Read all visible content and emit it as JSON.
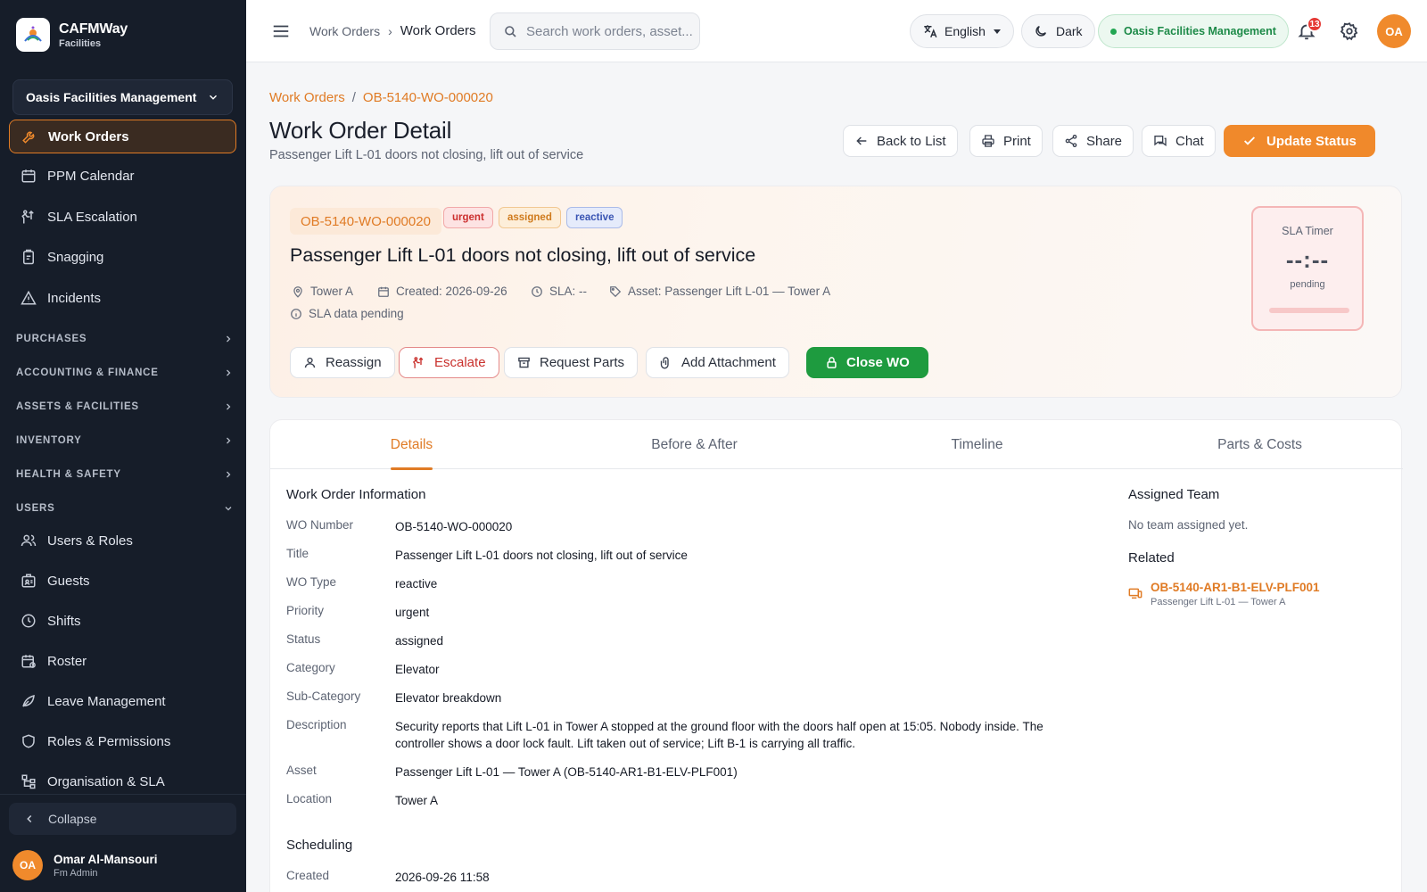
{
  "brand": {
    "name": "CAFMWay",
    "sub": "Facilities"
  },
  "sidebar": {
    "org_select": "Oasis Facilities Management",
    "items": [
      {
        "label": "Work Orders",
        "icon": "wrench-icon"
      },
      {
        "label": "PPM Calendar",
        "icon": "calendar-icon"
      },
      {
        "label": "SLA Escalation",
        "icon": "escalation-icon"
      },
      {
        "label": "Snagging",
        "icon": "clipboard-icon"
      },
      {
        "label": "Incidents",
        "icon": "warning-icon"
      }
    ],
    "sections": [
      "PURCHASES",
      "ACCOUNTING & FINANCE",
      "ASSETS & FACILITIES",
      "INVENTORY",
      "HEALTH & SAFETY",
      "USERS"
    ],
    "user_items": [
      {
        "label": "Users & Roles",
        "icon": "users-icon"
      },
      {
        "label": "Guests",
        "icon": "guest-badge-icon"
      },
      {
        "label": "Shifts",
        "icon": "clock-icon"
      },
      {
        "label": "Roster",
        "icon": "roster-icon"
      },
      {
        "label": "Leave Management",
        "icon": "leave-icon"
      },
      {
        "label": "Roles & Permissions",
        "icon": "shield-icon"
      },
      {
        "label": "Organisation & SLA",
        "icon": "org-chart-icon"
      }
    ],
    "collapse": "Collapse",
    "user": {
      "initials": "OA",
      "name": "Omar Al-Mansouri",
      "role": "Fm Admin"
    }
  },
  "topbar": {
    "breadcrumb": [
      "Work Orders",
      "Work Orders"
    ],
    "search_placeholder": "Search work orders, asset...",
    "language": "English",
    "theme": "Dark",
    "org": "Oasis Facilities Management",
    "notifications": "13",
    "avatar": "OA"
  },
  "page": {
    "breadcrumb": [
      "Work Orders",
      "OB-5140-WO-000020"
    ],
    "title": "Work Order Detail",
    "subtitle": "Passenger Lift L-01 doors not closing, lift out of service",
    "buttons": {
      "back": "Back to List",
      "print": "Print",
      "share": "Share",
      "chat": "Chat",
      "update": "Update Status"
    }
  },
  "hero": {
    "code": "OB-5140-WO-000020",
    "tags": {
      "priority": "urgent",
      "status": "assigned",
      "type": "reactive"
    },
    "title": "Passenger Lift L-01 doors not closing, lift out of service",
    "meta": {
      "location": "Tower A",
      "created": "Created: 2026-09-26",
      "sla": "SLA: --",
      "asset": "Asset: Passenger Lift L-01 — Tower A"
    },
    "sla_note": "SLA data pending",
    "actions": {
      "reassign": "Reassign",
      "escalate": "Escalate",
      "parts": "Request Parts",
      "attach": "Add Attachment",
      "close": "Close WO"
    },
    "sla_timer": {
      "label": "SLA Timer",
      "value": "--:--",
      "state": "pending"
    }
  },
  "tabs": [
    "Details",
    "Before & After",
    "Timeline",
    "Parts & Costs"
  ],
  "details": {
    "section_title": "Work Order Information",
    "fields": [
      {
        "k": "WO Number",
        "v": "OB-5140-WO-000020"
      },
      {
        "k": "Title",
        "v": "Passenger Lift L-01 doors not closing, lift out of service"
      },
      {
        "k": "WO Type",
        "v": "reactive"
      },
      {
        "k": "Priority",
        "v": "urgent"
      },
      {
        "k": "Status",
        "v": "assigned"
      },
      {
        "k": "Category",
        "v": "Elevator"
      },
      {
        "k": "Sub-Category",
        "v": "Elevator breakdown"
      },
      {
        "k": "Description",
        "v": "Security reports that Lift L-01 in Tower A stopped at the ground floor with the doors half open at 15:05. Nobody inside. The controller shows a door lock fault. Lift taken out of service; Lift B-1 is carrying all traffic."
      },
      {
        "k": "Asset",
        "v": "Passenger Lift L-01 — Tower A (OB-5140-AR1-B1-ELV-PLF001)"
      },
      {
        "k": "Location",
        "v": "Tower A"
      }
    ],
    "scheduling_title": "Scheduling",
    "scheduling": [
      {
        "k": "Created",
        "v": "2026-09-26 11:58"
      }
    ],
    "assigned_title": "Assigned Team",
    "assigned_empty": "No team assigned yet.",
    "related_title": "Related",
    "related": {
      "code": "OB-5140-AR1-B1-ELV-PLF001",
      "sub": "Passenger Lift L-01 — Tower A"
    }
  },
  "colors": {
    "accent": "#F0892B",
    "sidebar": "#161D29",
    "success": "#1E9B3F",
    "danger": "#C9302C"
  }
}
